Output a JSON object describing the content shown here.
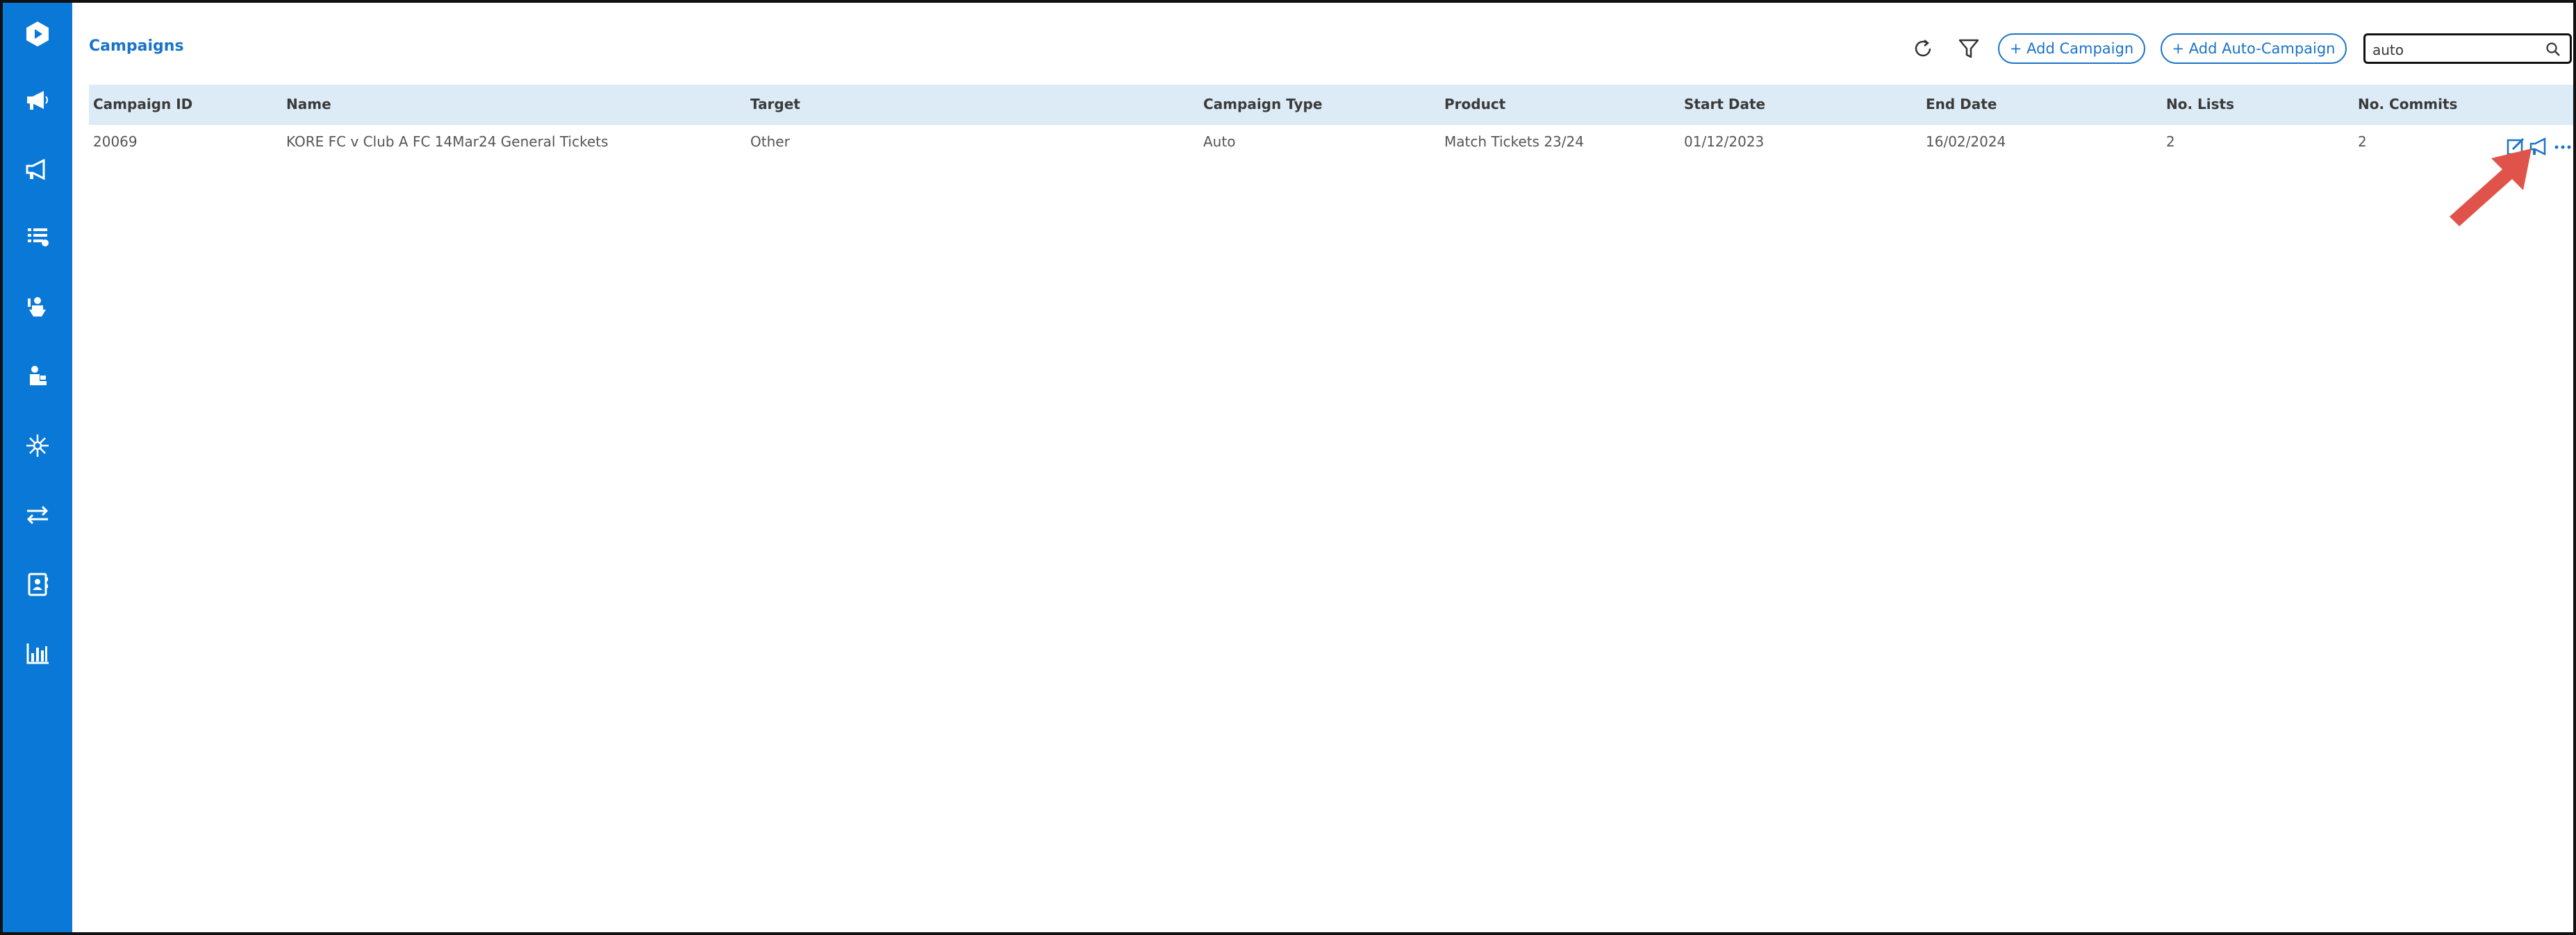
{
  "header": {
    "title": "Campaigns",
    "add_campaign_label": "+ Add Campaign",
    "add_auto_campaign_label": "+ Add Auto-Campaign",
    "search_value": "auto"
  },
  "sidebar": {
    "items": [
      {
        "icon": "logo-icon"
      },
      {
        "icon": "megaphone-icon"
      },
      {
        "icon": "megaphone-outline-icon"
      },
      {
        "icon": "list-icon"
      },
      {
        "icon": "person-hand-icon"
      },
      {
        "icon": "person-desk-icon"
      },
      {
        "icon": "network-icon"
      },
      {
        "icon": "transfer-icon"
      },
      {
        "icon": "contact-book-icon"
      },
      {
        "icon": "bar-chart-icon"
      }
    ]
  },
  "table": {
    "columns": [
      "Campaign ID",
      "Name",
      "Target",
      "Campaign Type",
      "Product",
      "Start Date",
      "End Date",
      "No. Lists",
      "No. Commits"
    ],
    "rows": [
      {
        "campaign_id": "20069",
        "name": "KORE FC v Club A FC 14Mar24 General Tickets",
        "target": "Other",
        "campaign_type": "Auto",
        "product": "Match Tickets 23/24",
        "start_date": "01/12/2023",
        "end_date": "16/02/2024",
        "lists": "2",
        "commits": "2"
      }
    ]
  },
  "colors": {
    "sidebar": "#0a78d7",
    "accent": "#1a73c8",
    "table_header": "#dcebf6",
    "annotation_arrow": "#e0534a"
  }
}
